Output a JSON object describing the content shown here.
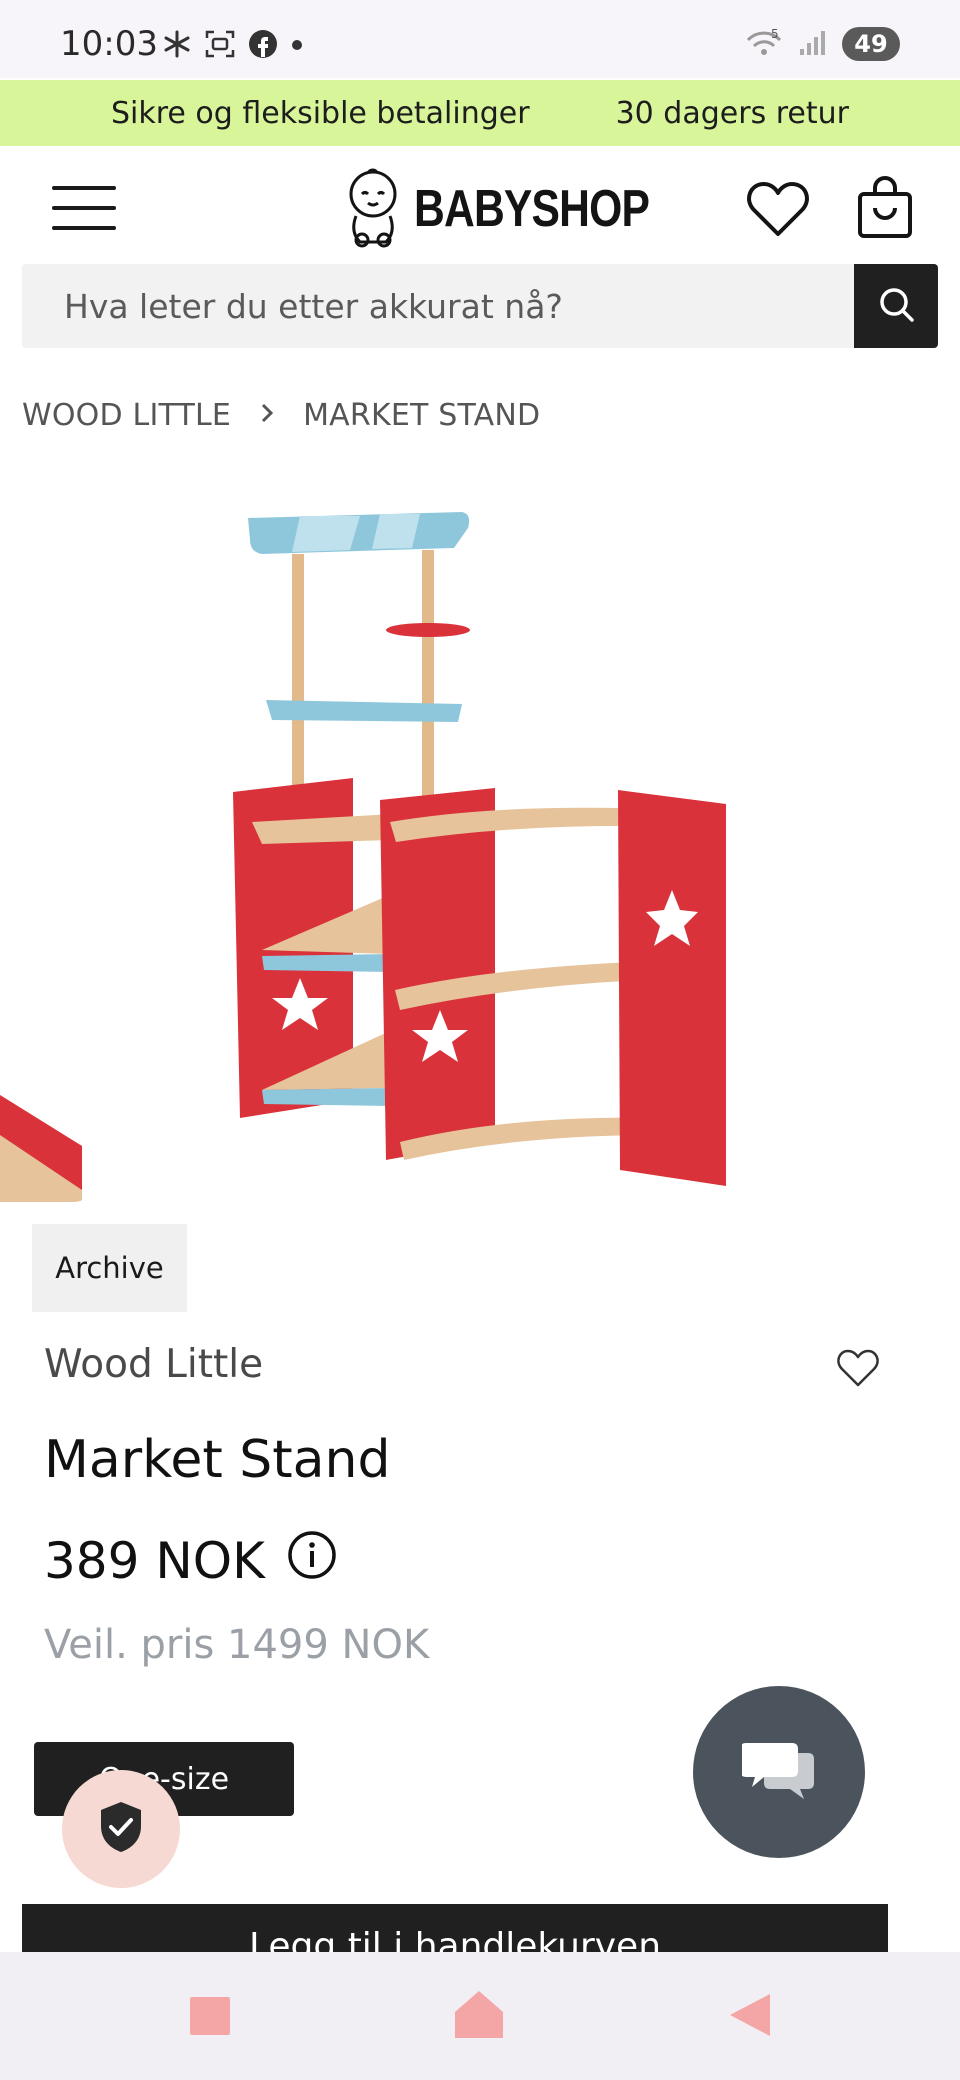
{
  "status_bar": {
    "time": "10:03",
    "battery": "49",
    "network": "5"
  },
  "promo": {
    "item1": "Sikre og fleksible betalinger",
    "item2": "30 dagers retur"
  },
  "header": {
    "logo_text": "BABYSHOP"
  },
  "search": {
    "placeholder": "Hva leter du etter akkurat nå?"
  },
  "breadcrumb": {
    "items": [
      "WOOD LITTLE",
      "MARKET STAND"
    ]
  },
  "product": {
    "tag": "Archive",
    "brand": "Wood Little",
    "name": "Market Stand",
    "price": "389 NOK",
    "rrp": "Veil. pris 1499 NOK",
    "size_label": "One-size",
    "add_to_cart": "Legg til i handlekurven"
  },
  "colors": {
    "promo_bg": "#d8f59a",
    "dark": "#202020",
    "chat_bg": "#4b545c",
    "trust_bg": "#f6d9d2",
    "stand_red": "#d9323a",
    "stand_blue": "#8ec7dc",
    "wood": "#e9c79a"
  },
  "icons": [
    "asterisk-icon",
    "screenshot-icon",
    "facebook-icon",
    "dot-icon",
    "wifi-icon",
    "signal-icon",
    "menu-icon",
    "baby-logo-icon",
    "heart-icon",
    "bag-icon",
    "search-icon",
    "chevron-right-icon",
    "info-icon",
    "shield-check-icon",
    "chat-icon",
    "recent-apps-icon",
    "home-icon",
    "back-icon"
  ]
}
